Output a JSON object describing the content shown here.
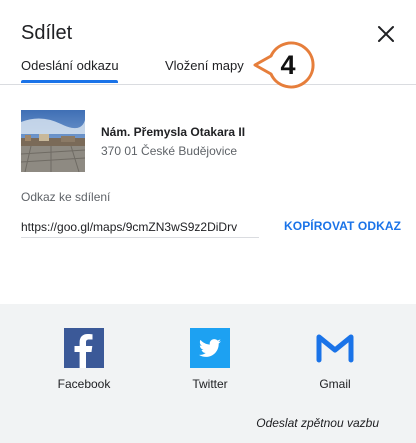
{
  "dialog": {
    "title": "Sdílet",
    "close_icon": "close-icon"
  },
  "tabs": [
    {
      "label": "Odeslání odkazu",
      "active": true
    },
    {
      "label": "Vložení mapy",
      "active": false
    }
  ],
  "callout": {
    "number": "4"
  },
  "place": {
    "name": "Nám. Přemysla Otakara II",
    "address": "370 01 České Budějovice"
  },
  "share": {
    "label": "Odkaz ke sdílení",
    "url": "https://goo.gl/maps/9cmZN3wS9z2DiDrv",
    "copy_label": "KOPÍROVAT ODKAZ"
  },
  "social": [
    {
      "label": "Facebook",
      "icon": "facebook-icon"
    },
    {
      "label": "Twitter",
      "icon": "twitter-icon"
    },
    {
      "label": "Gmail",
      "icon": "gmail-icon"
    }
  ],
  "feedback": "Odeslat zpětnou vazbu",
  "colors": {
    "accent": "#1a73e8",
    "callout": "#e67e3b",
    "facebook": "#3b5998",
    "twitter": "#1da1f2",
    "gmail": "#1a73e8",
    "footer_bg": "#f1f3f4"
  }
}
